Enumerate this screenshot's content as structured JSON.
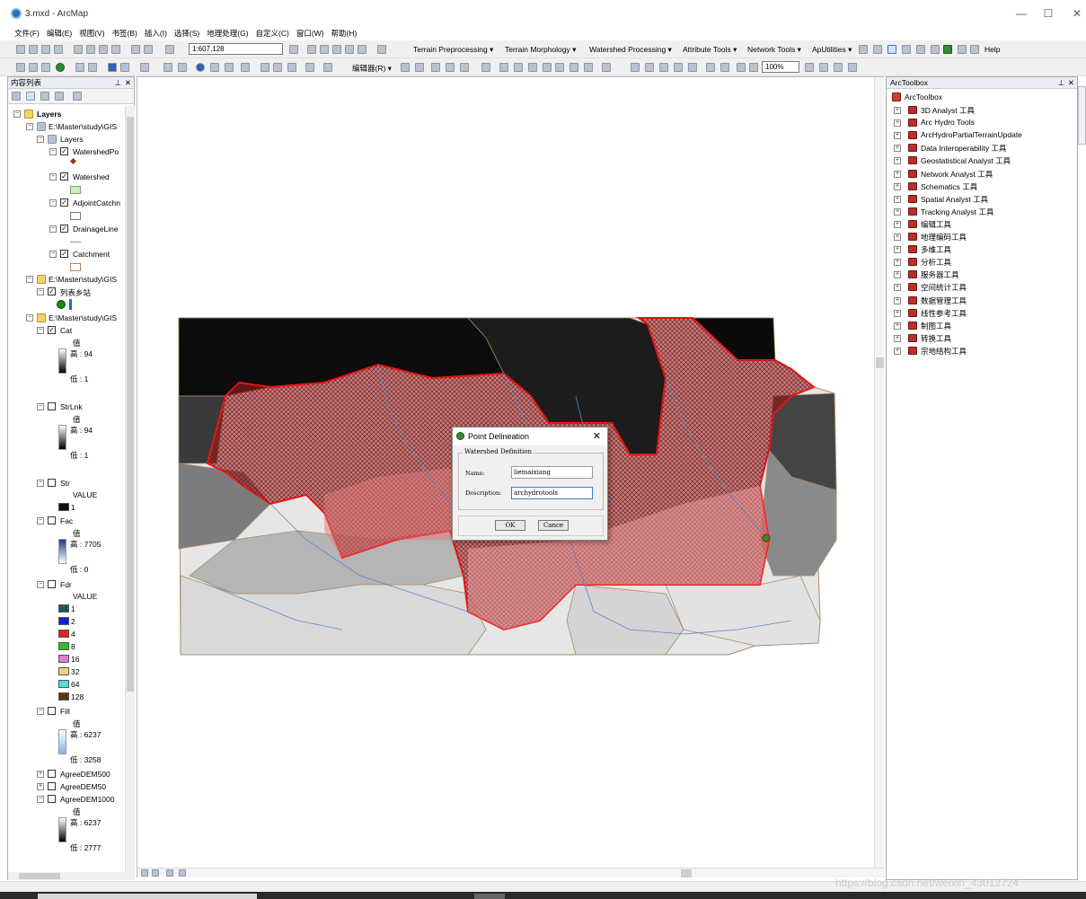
{
  "window": {
    "title": "3.mxd - ArcMap",
    "minimize": "—",
    "maximize": "☐",
    "close": "✕"
  },
  "menu": [
    "文件(F)",
    "编辑(E)",
    "视图(V)",
    "书签(B)",
    "插入(I)",
    "选择(S)",
    "地理处理(G)",
    "自定义(C)",
    "窗口(W)",
    "帮助(H)"
  ],
  "toolbar1": {
    "scale": "1:607,128",
    "menus": [
      "Terrain Preprocessing ▾",
      "Terrain Morphology ▾",
      "Watershed Processing ▾",
      "Attribute Tools ▾",
      "Network Tools ▾",
      "ApUtilities ▾"
    ],
    "help": "Help"
  },
  "toolbar2": {
    "editor": "编辑器(R) ▾",
    "zoom": "100%"
  },
  "toc": {
    "title": "内容列表",
    "root": "Layers",
    "items": [
      {
        "label": "E:\\Master\\study\\GIS"
      },
      {
        "label": "Layers"
      },
      {
        "label": "WatershedPo"
      },
      {
        "label": "Watershed"
      },
      {
        "label": "AdjointCatchn"
      },
      {
        "label": "DrainageLine"
      },
      {
        "label": "Catchment"
      },
      {
        "label": "E:\\Master\\study\\GIS"
      },
      {
        "label": "列表乡站"
      },
      {
        "label": "E:\\Master\\study\\GIS"
      },
      {
        "label": "Cat"
      },
      {
        "label": "StrLnk"
      },
      {
        "label": "Str"
      },
      {
        "label": "Fac"
      },
      {
        "label": "Fdr"
      },
      {
        "label": "Fill"
      },
      {
        "label": "AgreeDEM500"
      },
      {
        "label": "AgreeDEM50"
      },
      {
        "label": "AgreeDEM1000"
      }
    ],
    "legend": {
      "val": "值",
      "value": "VALUE",
      "cat_high": "高 : 94",
      "cat_low": "低 : 1",
      "strlnk_high": "高 : 94",
      "strlnk_low": "低 : 1",
      "str_val": "1",
      "fac_high": "高 : 7705",
      "fac_low": "低 : 0",
      "fdr_values": [
        "1",
        "2",
        "4",
        "8",
        "16",
        "32",
        "64",
        "128"
      ],
      "fdr_colors": [
        "#1c5a5a",
        "#1a1ae6",
        "#e61e1e",
        "#27c227",
        "#e17ad0",
        "#f0d27a",
        "#46e6d2",
        "#5a3712"
      ],
      "fill_high": "高 : 6237",
      "fill_low": "低 : 3258",
      "dem_high": "高 : 6237",
      "dem_low": "低 : 2777"
    }
  },
  "dialog": {
    "title": "Point Delineation",
    "group": "Watershed Definition",
    "name_label": "Name:",
    "name_value": "liemaixiang",
    "desc_label": "Description:",
    "desc_value": "archydrotools",
    "ok": "OK",
    "cancel": "Cance"
  },
  "arctoolbox": {
    "title": "ArcToolbox",
    "root": "ArcToolbox",
    "items": [
      "3D Analyst 工具",
      "Arc Hydro Tools",
      "ArcHydroPartialTerrainUpdate",
      "Data Interoperability 工具",
      "Geostatistical Analyst 工具",
      "Network Analyst 工具",
      "Schematics 工具",
      "Spatial Analyst 工具",
      "Tracking Analyst 工具",
      "编辑工具",
      "地理编码工具",
      "多维工具",
      "分析工具",
      "服务器工具",
      "空间统计工具",
      "数据管理工具",
      "线性参考工具",
      "制图工具",
      "转换工具",
      "宗地结构工具"
    ]
  },
  "watermark": "https://blog.csdn.net/weixin_43012724"
}
